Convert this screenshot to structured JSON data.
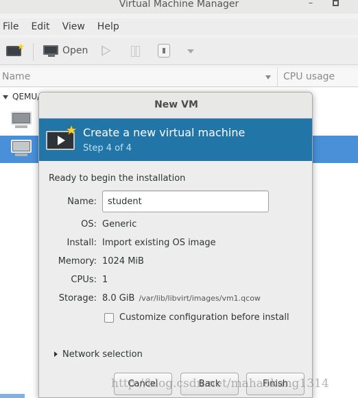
{
  "window": {
    "title": "Virtual Machine Manager",
    "minimize_glyph": "–"
  },
  "menubar": {
    "items": [
      "File",
      "Edit",
      "View",
      "Help"
    ]
  },
  "toolbar": {
    "open_label": "Open",
    "icons": [
      "new-vm-icon",
      "monitor-icon",
      "play-icon",
      "pause-icon",
      "power-icon",
      "dropdown-arrow-icon"
    ]
  },
  "vm_list": {
    "columns": [
      "Name",
      "CPU usage"
    ],
    "connection_label": "QEMU/",
    "selected_row_color": "#4a90d9"
  },
  "dialog": {
    "title": "New VM",
    "banner": {
      "title": "Create a new virtual machine",
      "step": "Step 4 of 4",
      "color": "#2175a7"
    },
    "ready_text": "Ready to begin the installation",
    "name_label": "Name:",
    "name_value": "student",
    "fields": [
      {
        "label": "OS:",
        "value": "Generic"
      },
      {
        "label": "Install:",
        "value": "Import existing OS image"
      },
      {
        "label": "Memory:",
        "value": "1024 MiB"
      },
      {
        "label": "CPUs:",
        "value": "1"
      },
      {
        "label": "Storage:",
        "value": "8.0 GiB",
        "sub": "/var/lib/libvirt/images/vm1.qcow"
      }
    ],
    "customize_label": "Customize configuration before install",
    "customize_checked": false,
    "network_label": "Network selection",
    "buttons": {
      "cancel": "Cancel",
      "back": "Back",
      "finish": "Finish"
    }
  },
  "watermark": "http://blog.csdn.net/mahaokang1314"
}
